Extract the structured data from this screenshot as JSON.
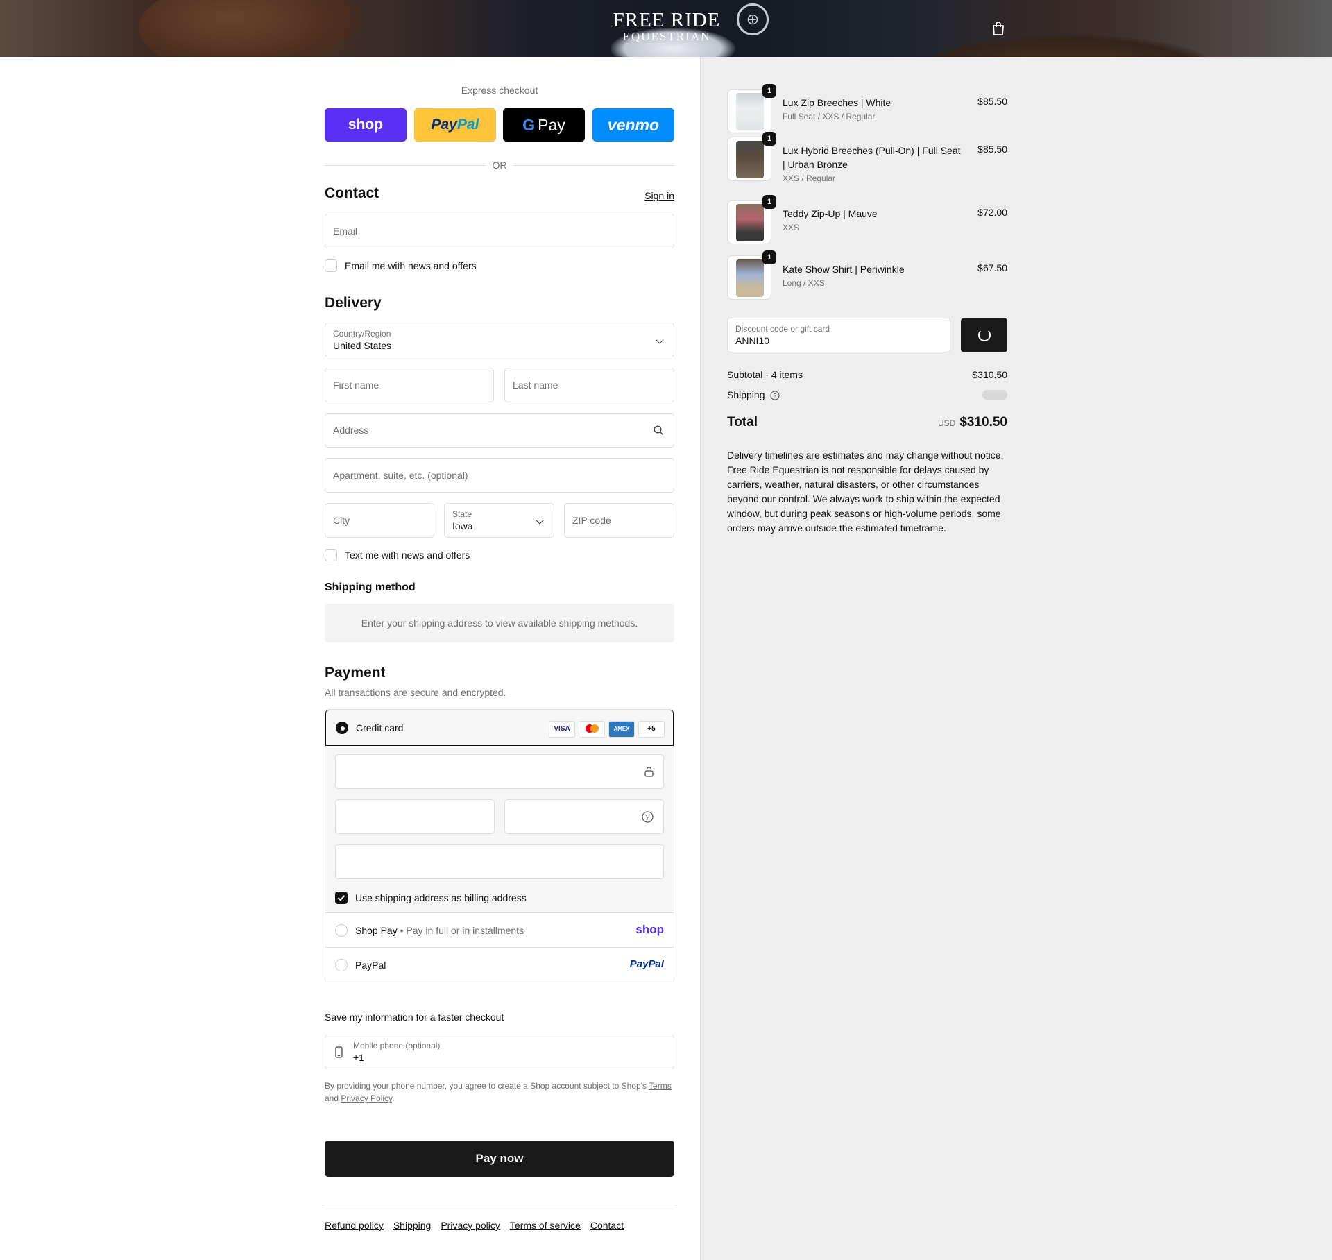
{
  "header": {
    "brand_line1": "FREE RIDE",
    "brand_line2": "EQUESTRIAN",
    "cart_icon": "shopping-bag-icon"
  },
  "express": {
    "title": "Express checkout",
    "buttons": [
      "shop",
      "PayPal",
      "G Pay",
      "venmo"
    ],
    "or_label": "OR"
  },
  "contact": {
    "heading": "Contact",
    "sign_in": "Sign in",
    "email_placeholder": "Email",
    "news_label": "Email me with news and offers"
  },
  "delivery": {
    "heading": "Delivery",
    "country_label": "Country/Region",
    "country_value": "United States",
    "first_name_placeholder": "First name",
    "last_name_placeholder": "Last name",
    "address_placeholder": "Address",
    "apartment_placeholder": "Apartment, suite, etc. (optional)",
    "city_placeholder": "City",
    "state_label": "State",
    "state_value": "Iowa",
    "zip_placeholder": "ZIP code",
    "text_label": "Text me with news and offers"
  },
  "shipping_method": {
    "heading": "Shipping method",
    "message": "Enter your shipping address to view available shipping methods."
  },
  "payment": {
    "heading": "Payment",
    "subtitle": "All transactions are secure and encrypted.",
    "credit_card_label": "Credit card",
    "card_badges": [
      "VISA",
      "MC",
      "AMEX",
      "+5"
    ],
    "billing_label": "Use shipping address as billing address",
    "shop_pay_label": "Shop Pay",
    "shop_pay_sub": "Pay in full or in installments",
    "shop_pay_logo": "shop",
    "paypal_label": "PayPal",
    "paypal_logo": "PayPal"
  },
  "save_info": {
    "heading": "Save my information for a faster checkout",
    "phone_label": "Mobile phone (optional)",
    "phone_value": "+1",
    "disclaimer_start": "By providing your phone number, you agree to create a Shop account subject to Shop's ",
    "terms": "Terms",
    "and": " and ",
    "privacy": "Privacy Policy",
    "end": "."
  },
  "pay_now": "Pay now",
  "footer": [
    "Refund policy",
    "Shipping",
    "Privacy policy",
    "Terms of service",
    "Contact"
  ],
  "cart": {
    "items": [
      {
        "name": "Lux Zip Breeches | White",
        "variant": "Full Seat / XXS / Regular",
        "price": "$85.50",
        "qty": "1",
        "color": "#e7e9ea"
      },
      {
        "name": "Lux Hybrid Breeches (Pull-On) | Full Seat | Urban Bronze",
        "variant": "XXS / Regular",
        "price": "$85.50",
        "qty": "1",
        "color": "#5a4b3c"
      },
      {
        "name": "Teddy Zip-Up | Mauve",
        "variant": "XXS",
        "price": "$72.00",
        "qty": "1",
        "color": "#b7656c"
      },
      {
        "name": "Kate Show Shirt | Periwinkle",
        "variant": "Long / XXS",
        "price": "$67.50",
        "qty": "1",
        "color": "#9fb3d6"
      }
    ],
    "discount_label": "Discount code or gift card",
    "discount_value": "ANNI10",
    "subtotal_label": "Subtotal · 4 items",
    "subtotal_value": "$310.50",
    "shipping_label": "Shipping",
    "total_label": "Total",
    "currency": "USD",
    "total_value": "$310.50",
    "note": "Delivery timelines are estimates and may change without notice. Free Ride Equestrian is not responsible for delays caused by carriers, weather, natural disasters, or other circumstances beyond our control. We always work to ship within the expected window, but during peak seasons or high-volume periods, some orders may arrive outside the estimated timeframe."
  }
}
